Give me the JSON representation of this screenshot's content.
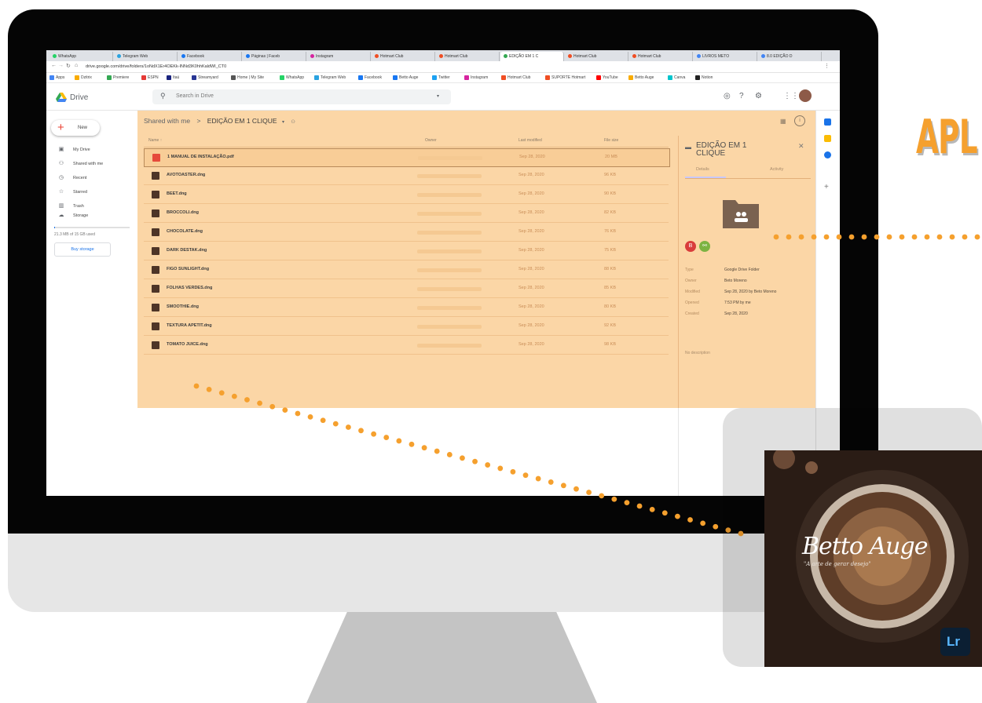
{
  "browser": {
    "tabs": [
      {
        "label": "WhatsApp",
        "icon": "whatsapp-icon",
        "color": "#25d366"
      },
      {
        "label": "Telegram Web",
        "icon": "telegram-icon",
        "color": "#2aa3e0"
      },
      {
        "label": "Facebook",
        "icon": "facebook-icon",
        "color": "#1877f2"
      },
      {
        "label": "Páginas | Faceb",
        "icon": "facebook-icon",
        "color": "#1877f2"
      },
      {
        "label": "Instagram",
        "icon": "instagram-icon",
        "color": "#d6249f"
      },
      {
        "label": "Hotmart Club",
        "icon": "hotmart-icon",
        "color": "#f04e23"
      },
      {
        "label": "Hotmart Club",
        "icon": "hotmart-icon",
        "color": "#f04e23"
      },
      {
        "label": "EDIÇÃO EM 1 C",
        "icon": "drive-icon",
        "color": "#34a853",
        "active": true
      },
      {
        "label": "Hotmart Club",
        "icon": "hotmart-icon",
        "color": "#f04e23"
      },
      {
        "label": "Hotmart Club",
        "icon": "hotmart-icon",
        "color": "#f04e23"
      },
      {
        "label": "LIVROS METO",
        "icon": "chrome-icon",
        "color": "#4285f4"
      },
      {
        "label": "8.0 EDIÇÃO D",
        "icon": "chrome-icon",
        "color": "#4285f4"
      }
    ],
    "url": "drive.google.com/drive/folders/1oNdX1Er4OEKk-INNd3K0hhKaldWI_CT0",
    "bookmarks": [
      {
        "label": "Apps",
        "color": "#4285f4"
      },
      {
        "label": "Dzitrix",
        "color": "#f9ab00"
      },
      {
        "label": "Premiere",
        "color": "#34a853"
      },
      {
        "label": "ESPN",
        "color": "#e53935"
      },
      {
        "label": "Itaú",
        "color": "#1a237e"
      },
      {
        "label": "Streamyard",
        "color": "#283593"
      },
      {
        "label": "Home | My Site",
        "color": "#555555"
      },
      {
        "label": "WhatsApp",
        "color": "#25d366"
      },
      {
        "label": "Telegram Web",
        "color": "#2aa3e0"
      },
      {
        "label": "Facebook",
        "color": "#1877f2"
      },
      {
        "label": "Betto Auge",
        "color": "#1877f2"
      },
      {
        "label": "Twitter",
        "color": "#1da1f2"
      },
      {
        "label": "Instagram",
        "color": "#d6249f"
      },
      {
        "label": "Hotmart Club",
        "color": "#f04e23"
      },
      {
        "label": "SUPORTE Hotmart",
        "color": "#f04e23"
      },
      {
        "label": "YouTube",
        "color": "#ff0000"
      },
      {
        "label": "Betto Auge",
        "color": "#f9ab00"
      },
      {
        "label": "Canva",
        "color": "#00c4cc"
      },
      {
        "label": "Notion",
        "color": "#222222"
      }
    ]
  },
  "drive": {
    "app_title": "Drive",
    "search_placeholder": "Search in Drive",
    "new_label": "New",
    "nav": [
      {
        "label": "My Drive",
        "icon": "my-drive-icon"
      },
      {
        "label": "Shared with me",
        "icon": "shared-icon"
      },
      {
        "label": "Recent",
        "icon": "clock-icon"
      },
      {
        "label": "Starred",
        "icon": "star-icon"
      },
      {
        "label": "Trash",
        "icon": "trash-icon"
      }
    ],
    "storage_label": "Storage",
    "storage_used_text": "21.3 MB of 15 GB used",
    "storage_fraction": 0.0014,
    "buy_storage": "Buy storage",
    "breadcrumb": {
      "parent": "Shared with me",
      "sep": ">",
      "current": "EDIÇÃO EM 1 CLIQUE"
    },
    "columns": {
      "name": "Name ↑",
      "owner": "Owner",
      "modified": "Last modified",
      "size": "File size"
    },
    "files": [
      {
        "name": "1 MANUAL DE INSTALAÇÃO.pdf",
        "modified": "Sep 28, 2020",
        "size": "20 MB",
        "type": "pdf"
      },
      {
        "name": "AVOTOASTER.dng",
        "modified": "Sep 28, 2020",
        "size": "96 KB",
        "type": "dng"
      },
      {
        "name": "BEET.dng",
        "modified": "Sep 28, 2020",
        "size": "90 KB",
        "type": "dng"
      },
      {
        "name": "BROCCOLI.dng",
        "modified": "Sep 28, 2020",
        "size": "82 KB",
        "type": "dng"
      },
      {
        "name": "CHOCOLATE.dng",
        "modified": "Sep 28, 2020",
        "size": "76 KB",
        "type": "dng"
      },
      {
        "name": "DARK DESTAK.dng",
        "modified": "Sep 28, 2020",
        "size": "75 KB",
        "type": "dng"
      },
      {
        "name": "FIGO SUNLIGHT.dng",
        "modified": "Sep 28, 2020",
        "size": "88 KB",
        "type": "dng"
      },
      {
        "name": "FOLHAS VERDES.dng",
        "modified": "Sep 28, 2020",
        "size": "85 KB",
        "type": "dng"
      },
      {
        "name": "SMOOTHIE.dng",
        "modified": "Sep 28, 2020",
        "size": "80 KB",
        "type": "dng"
      },
      {
        "name": "TEXTURA APETIT.dng",
        "modified": "Sep 28, 2020",
        "size": "92 KB",
        "type": "dng"
      },
      {
        "name": "TOMATO JUICE.dng",
        "modified": "Sep 28, 2020",
        "size": "98 KB",
        "type": "dng"
      }
    ],
    "details": {
      "title": "EDIÇÃO EM 1 CLIQUE",
      "tab_details": "Details",
      "tab_activity": "Activity",
      "props": [
        {
          "key": "Type",
          "value": "Google Drive Folder"
        },
        {
          "key": "Owner",
          "value": "Beto Moreno"
        },
        {
          "key": "Modified",
          "value": "Sep 28, 2020 by Beto Moreno"
        },
        {
          "key": "Opened",
          "value": "7:53 PM by me"
        },
        {
          "key": "Created",
          "value": "Sep 28, 2020"
        }
      ],
      "no_description": "No description",
      "avatar_letter": "B"
    }
  },
  "overlay": {
    "headline": "APL",
    "brand": "Betto Auge",
    "tagline": "\"A arte de gerar desejo\"",
    "lr_badge": "Lr",
    "accent": "#f5a02e"
  }
}
